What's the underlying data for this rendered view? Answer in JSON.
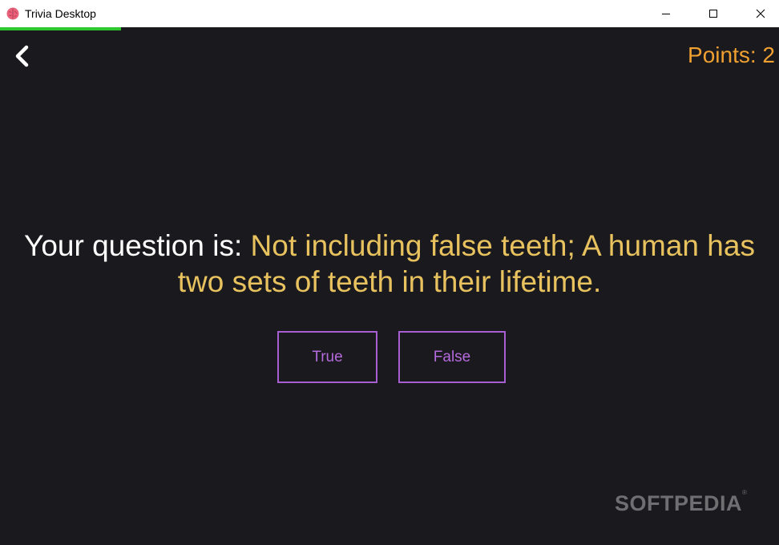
{
  "window": {
    "title": "Trivia Desktop",
    "progress_fraction": 0.155
  },
  "header": {
    "back_icon": "chevron-left-icon",
    "points_text": "Points: 2"
  },
  "question": {
    "prefix": "Your question is: ",
    "text": "Not including false teeth; A human has two sets of teeth in their lifetime."
  },
  "answers": {
    "true_label": "True",
    "false_label": "False"
  },
  "watermark": {
    "text": "SOFTPEDIA",
    "mark": "®"
  },
  "colors": {
    "background": "#1a1a1e",
    "points": "#f0a030",
    "question_text": "#e8c25e",
    "answer_border": "#a55fd0",
    "progress": "#2ec82e"
  }
}
